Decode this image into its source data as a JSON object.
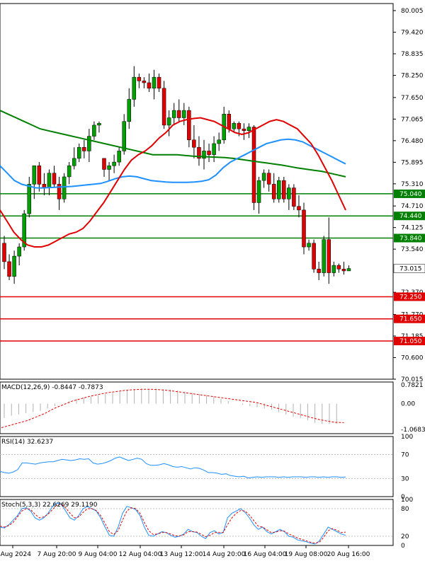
{
  "chart_data": [
    {
      "type": "candlestick",
      "instrument_panel": "price",
      "ylim": [
        70.015,
        80.005
      ],
      "y_ticks": [
        "80.005",
        "79.420",
        "78.835",
        "78.250",
        "77.650",
        "77.065",
        "76.480",
        "75.895",
        "75.310",
        "74.710",
        "74.125",
        "73.540",
        "72.370",
        "71.770",
        "71.185",
        "70.600",
        "70.015"
      ],
      "colors": {
        "bull": "#00a000",
        "bear": "#e00000",
        "sma_red": "#e00000",
        "sma_blue": "#1e90ff",
        "sma_green": "#008000",
        "hline_green": "#008000",
        "hline_red": "#e00000"
      },
      "horizontal_lines": [
        {
          "value": 75.04,
          "label": "75.040",
          "color": "#008000"
        },
        {
          "value": 74.44,
          "label": "74.440",
          "color": "#008000"
        },
        {
          "value": 73.84,
          "label": "73.840",
          "color": "#008000"
        },
        {
          "value": 72.25,
          "label": "72.250",
          "color": "#e00000"
        },
        {
          "value": 71.65,
          "label": "71.650",
          "color": "#e00000"
        },
        {
          "value": 71.05,
          "label": "71.050",
          "color": "#e00000"
        }
      ],
      "current_price": {
        "value": 73.015,
        "label": "73.015"
      },
      "candles": [
        [
          73.7,
          73.9,
          73.0,
          73.2
        ],
        [
          73.2,
          73.4,
          72.7,
          72.8
        ],
        [
          72.8,
          73.5,
          72.6,
          73.35
        ],
        [
          73.35,
          73.7,
          73.1,
          73.6
        ],
        [
          73.6,
          74.6,
          73.5,
          74.5
        ],
        [
          74.5,
          75.5,
          74.4,
          75.3
        ],
        [
          75.3,
          75.8,
          74.9,
          75.8
        ],
        [
          75.8,
          75.9,
          75.1,
          75.3
        ],
        [
          75.3,
          75.6,
          75.0,
          75.2
        ],
        [
          75.2,
          75.7,
          75.0,
          75.6
        ],
        [
          75.6,
          75.8,
          75.2,
          75.3
        ],
        [
          75.3,
          75.5,
          74.6,
          74.9
        ],
        [
          74.9,
          75.6,
          74.8,
          75.5
        ],
        [
          75.5,
          75.9,
          75.3,
          75.8
        ],
        [
          75.8,
          76.3,
          75.7,
          76.0
        ],
        [
          76.0,
          76.4,
          75.9,
          76.3
        ],
        [
          76.3,
          76.5,
          76.0,
          76.2
        ],
        [
          76.2,
          76.8,
          75.9,
          76.6
        ],
        [
          76.6,
          77.0,
          76.5,
          76.9
        ],
        [
          76.9,
          77.0,
          76.7,
          76.95
        ],
        [
          76.0,
          76.0,
          75.5,
          75.7
        ],
        [
          75.7,
          75.9,
          75.4,
          75.8
        ],
        [
          75.8,
          76.1,
          75.6,
          75.9
        ],
        [
          75.9,
          76.3,
          75.8,
          76.2
        ],
        [
          76.2,
          77.2,
          76.1,
          77.0
        ],
        [
          77.0,
          77.9,
          76.8,
          77.6
        ],
        [
          77.6,
          78.5,
          77.4,
          78.2
        ],
        [
          78.2,
          78.3,
          77.9,
          78.1
        ],
        [
          78.1,
          78.2,
          77.9,
          78.05
        ],
        [
          78.05,
          78.3,
          77.8,
          77.9
        ],
        [
          77.9,
          78.4,
          77.6,
          78.2
        ],
        [
          78.2,
          78.3,
          77.8,
          77.9
        ],
        [
          77.9,
          78.1,
          76.8,
          76.9
        ],
        [
          76.9,
          77.3,
          76.6,
          77.1
        ],
        [
          77.1,
          77.5,
          76.9,
          77.3
        ],
        [
          77.3,
          77.6,
          77.0,
          77.1
        ],
        [
          77.1,
          77.5,
          76.9,
          77.3
        ],
        [
          77.3,
          77.4,
          76.3,
          76.5
        ],
        [
          76.5,
          76.9,
          76.0,
          76.3
        ],
        [
          76.3,
          76.6,
          75.8,
          76.0
        ],
        [
          76.0,
          76.5,
          75.7,
          76.2
        ],
        [
          76.2,
          76.4,
          75.9,
          76.1
        ],
        [
          76.1,
          76.6,
          75.9,
          76.4
        ],
        [
          76.4,
          76.7,
          76.2,
          76.5
        ],
        [
          76.5,
          77.4,
          76.4,
          77.2
        ],
        [
          77.2,
          77.3,
          76.7,
          76.8
        ],
        [
          76.8,
          77.0,
          76.7,
          76.95
        ],
        [
          76.95,
          77.0,
          76.6,
          76.8
        ],
        [
          76.8,
          76.95,
          76.5,
          76.75
        ],
        [
          76.75,
          76.95,
          76.55,
          76.85
        ],
        [
          76.85,
          76.9,
          74.6,
          74.8
        ],
        [
          74.8,
          75.5,
          74.5,
          75.4
        ],
        [
          75.4,
          75.7,
          75.2,
          75.6
        ],
        [
          75.6,
          75.7,
          75.1,
          75.3
        ],
        [
          75.3,
          75.6,
          74.8,
          74.9
        ],
        [
          74.9,
          75.5,
          74.8,
          75.4
        ],
        [
          75.4,
          75.5,
          74.8,
          74.9
        ],
        [
          74.9,
          75.3,
          74.6,
          75.2
        ],
        [
          75.2,
          75.3,
          74.6,
          74.7
        ],
        [
          74.7,
          75.0,
          74.4,
          74.6
        ],
        [
          74.6,
          74.8,
          73.4,
          73.6
        ],
        [
          73.6,
          73.8,
          73.5,
          73.7
        ],
        [
          73.7,
          73.8,
          72.9,
          73.0
        ],
        [
          73.0,
          73.2,
          72.7,
          72.9
        ],
        [
          72.9,
          73.9,
          72.8,
          73.8
        ],
        [
          73.8,
          74.4,
          72.6,
          72.9
        ],
        [
          72.9,
          73.2,
          72.8,
          73.1
        ],
        [
          73.1,
          73.15,
          72.9,
          73.0
        ],
        [
          73.0,
          73.2,
          72.85,
          72.95
        ],
        [
          72.95,
          73.1,
          72.95,
          73.015
        ]
      ],
      "sma_red": [
        74.6,
        74.3,
        74.0,
        73.8,
        73.65,
        73.6,
        73.6,
        73.65,
        73.75,
        73.85,
        73.95,
        74.0,
        74.1,
        74.3,
        74.55,
        74.8,
        75.1,
        75.4,
        75.7,
        75.95,
        76.1,
        76.2,
        76.35,
        76.55,
        76.7,
        76.9,
        77.0,
        77.05,
        77.08,
        77.1,
        77.05,
        77.0,
        76.9,
        76.8,
        76.7,
        76.65,
        76.7,
        76.8,
        76.9,
        77.0,
        77.05,
        77.0,
        76.9,
        76.8,
        76.6,
        76.4,
        76.1,
        75.75,
        75.4,
        75.0,
        74.6
      ],
      "sma_blue": [
        75.8,
        75.6,
        75.4,
        75.3,
        75.25,
        75.2,
        75.2,
        75.21,
        75.22,
        75.23,
        75.24,
        75.26,
        75.28,
        75.3,
        75.32,
        75.38,
        75.45,
        75.5,
        75.52,
        75.5,
        75.45,
        75.4,
        75.38,
        75.36,
        75.35,
        75.35,
        75.35,
        75.36,
        75.38,
        75.42,
        75.55,
        75.75,
        75.9,
        76.0,
        76.1,
        76.2,
        76.3,
        76.4,
        76.45,
        76.5,
        76.52,
        76.5,
        76.45,
        76.35,
        76.25,
        76.15,
        76.05,
        75.95,
        75.85
      ],
      "sma_green": [
        77.3,
        77.2,
        77.1,
        77.0,
        76.9,
        76.8,
        76.75,
        76.7,
        76.65,
        76.6,
        76.55,
        76.5,
        76.45,
        76.4,
        76.35,
        76.3,
        76.25,
        76.2,
        76.15,
        76.1,
        76.1,
        76.1,
        76.1,
        76.08,
        76.06,
        76.05,
        76.04,
        76.03,
        76.02,
        76.0,
        75.97,
        75.94,
        75.91,
        75.88,
        75.85,
        75.82,
        75.78,
        75.74,
        75.71,
        75.68,
        75.65,
        75.6,
        75.55,
        75.5
      ]
    },
    {
      "type": "bar",
      "name": "MACD(12,26,9) -0.8447 -0.7873",
      "ylim": [
        -1.25,
        0.9
      ],
      "y_ticks": [
        "0.7821",
        "0.00",
        "-1.0683"
      ],
      "histogram": [
        -0.6,
        -0.5,
        -0.45,
        -0.4,
        -0.35,
        -0.3,
        -0.2,
        -0.1,
        0.0,
        0.1,
        0.2,
        0.25,
        0.3,
        0.35,
        0.4,
        0.45,
        0.5,
        0.55,
        0.58,
        0.6,
        0.62,
        0.62,
        0.6,
        0.58,
        0.55,
        0.5,
        0.45,
        0.4,
        0.35,
        0.3,
        0.2,
        0.1,
        0.0,
        -0.05,
        -0.1,
        -0.15,
        -0.2,
        -0.25,
        -0.35,
        -0.45,
        -0.55,
        -0.6,
        -0.7,
        -0.8,
        -0.85,
        -0.85,
        -0.84
      ],
      "signal": [
        -1.0,
        -0.9,
        -0.8,
        -0.7,
        -0.55,
        -0.4,
        -0.2,
        -0.05,
        0.1,
        0.2,
        0.3,
        0.38,
        0.45,
        0.5,
        0.55,
        0.58,
        0.6,
        0.6,
        0.58,
        0.55,
        0.5,
        0.45,
        0.4,
        0.35,
        0.3,
        0.25,
        0.2,
        0.15,
        0.1,
        0.05,
        -0.05,
        -0.15,
        -0.25,
        -0.35,
        -0.45,
        -0.55,
        -0.65,
        -0.72,
        -0.78,
        -0.79
      ]
    },
    {
      "type": "line",
      "name": "RSI(14) 32.6237",
      "ylim": [
        0,
        100
      ],
      "y_ticks": [
        "100",
        "70",
        "30",
        "0"
      ],
      "levels": [
        70,
        30
      ],
      "values": [
        42,
        40,
        39,
        41,
        45,
        56,
        56,
        55,
        54,
        56,
        57,
        58,
        58,
        60,
        62,
        61,
        60,
        61,
        63,
        62,
        63,
        56,
        54,
        55,
        57,
        60,
        64,
        66,
        63,
        60,
        62,
        64,
        62,
        55,
        52,
        52,
        53,
        55,
        53,
        50,
        49,
        50,
        48,
        46,
        48,
        47,
        44,
        40,
        40,
        39,
        37,
        38,
        35,
        34,
        33,
        34,
        31,
        32,
        33,
        32,
        33,
        33,
        33,
        32,
        33,
        32,
        33,
        33,
        33,
        32,
        33,
        33,
        32,
        33,
        32,
        33,
        33,
        32,
        32.6
      ]
    },
    {
      "type": "line",
      "name": "Stoch(5,3,3) 22.6269 29.1190",
      "ylim": [
        0,
        100
      ],
      "y_ticks": [
        "100",
        "80",
        "20",
        "0"
      ],
      "levels": [
        80,
        20
      ],
      "main": [
        40,
        38,
        45,
        55,
        65,
        80,
        82,
        75,
        60,
        55,
        60,
        70,
        85,
        92,
        90,
        75,
        60,
        55,
        65,
        80,
        85,
        80,
        75,
        60,
        40,
        22,
        20,
        40,
        70,
        85,
        82,
        78,
        65,
        40,
        22,
        20,
        25,
        30,
        28,
        22,
        18,
        20,
        25,
        35,
        30,
        28,
        20,
        15,
        28,
        32,
        25,
        28,
        60,
        70,
        75,
        80,
        72,
        60,
        45,
        35,
        40,
        30,
        25,
        30,
        35,
        30,
        20,
        18,
        12,
        10,
        8,
        5,
        3,
        10,
        25,
        40,
        35,
        30,
        25,
        22
      ],
      "signal": [
        42,
        40,
        43,
        50,
        62,
        75,
        80,
        78,
        68,
        60,
        62,
        68,
        78,
        88,
        90,
        82,
        70,
        60,
        62,
        72,
        80,
        80,
        76,
        65,
        48,
        30,
        24,
        32,
        55,
        75,
        82,
        80,
        70,
        50,
        32,
        24,
        25,
        28,
        28,
        25,
        21,
        21,
        23,
        30,
        30,
        29,
        24,
        19,
        22,
        28,
        28,
        28,
        45,
        60,
        70,
        76,
        75,
        66,
        54,
        42,
        40,
        34,
        28,
        29,
        32,
        31,
        25,
        21,
        16,
        13,
        10,
        7,
        5,
        7,
        18,
        32,
        37,
        33,
        28,
        29
      ]
    },
    {
      "type": "axis",
      "x_tick_labels": [
        "6 Aug 2024",
        "7 Aug 20:00",
        "9 Aug 04:00",
        "12 Aug 04:00",
        "13 Aug 12:00",
        "14 Aug 20:00",
        "16 Aug 04:00",
        "19 Aug 08:00",
        "20 Aug 16:00"
      ]
    }
  ],
  "labels": {
    "macd": "MACD(12,26,9) -0.8447 -0.7873",
    "rsi": "RSI(14) 32.6237",
    "stoch": "Stoch(5,3,3) 22.6269 29.1190"
  }
}
